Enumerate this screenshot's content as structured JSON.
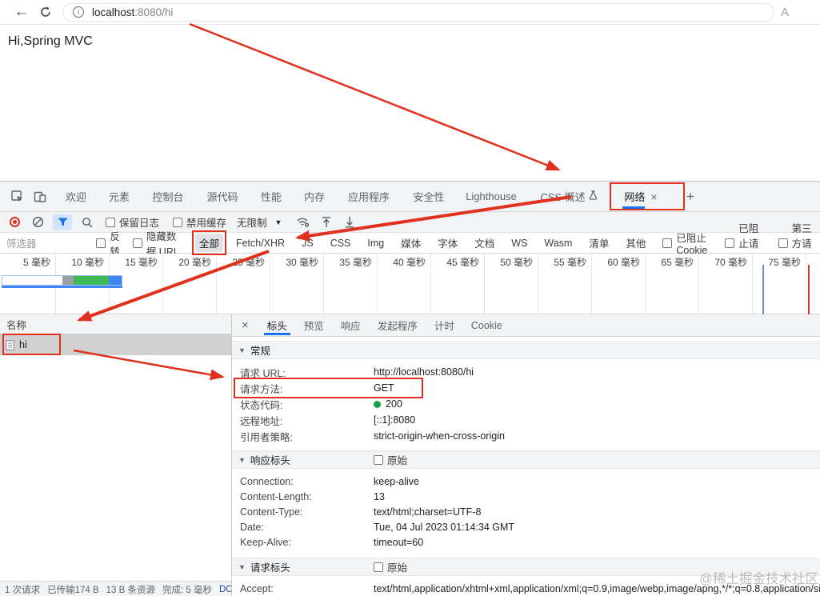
{
  "colors": {
    "annotation": "#e0301e",
    "accent": "#1a73e8",
    "record": "#d93025",
    "status_green": "#12a347",
    "selected_row": "#d0d0d0",
    "dcl_line": "#7086cf",
    "load_line": "#c9392c",
    "ov_gray": "#9aa0a6",
    "ov_green": "#3cba54",
    "ov_blue": "#4285f4"
  },
  "browser": {
    "url": {
      "host": "localhost",
      "rest": ":8080/hi"
    },
    "toolbar_right": "A",
    "page_text": "Hi,Spring MVC"
  },
  "devtools": {
    "tabs": [
      "欢迎",
      "元素",
      "控制台",
      "源代码",
      "性能",
      "内存",
      "应用程序",
      "安全性",
      "Lighthouse",
      "CSS 概述",
      "网络"
    ],
    "network_tab_close": "×",
    "add_tab": "+"
  },
  "network_panel": {
    "toolbar": {
      "preserve_log": "保留日志",
      "disable_cache": "禁用缓存",
      "throttling": "无限制"
    },
    "filter_bar": {
      "placeholder": "筛选器",
      "invert": "反转",
      "hide_data_urls": "隐藏数据 URL",
      "pills": [
        "全部",
        "Fetch/XHR",
        "JS",
        "CSS",
        "Img",
        "媒体",
        "字体",
        "文档",
        "WS",
        "Wasm",
        "清单",
        "其他"
      ],
      "checkboxes": [
        "已阻止 Cookie",
        "已阻止请求",
        "第三方请求"
      ]
    },
    "timeline": {
      "unit": "毫秒",
      "ticks": [
        5,
        10,
        15,
        20,
        25,
        30,
        35,
        40,
        45,
        50,
        55,
        60,
        65,
        70,
        75
      ]
    },
    "request_table": {
      "name_header": "名称",
      "rows": [
        {
          "name": "hi"
        }
      ]
    },
    "summary_bar": {
      "requests": "1 次请求",
      "transferred": "已传输174 B",
      "resources": "13 B 条资源",
      "finish": "完成: 5 毫秒",
      "domcontentloaded": "DC"
    }
  },
  "details": {
    "tabs": [
      "标头",
      "预览",
      "响应",
      "发起程序",
      "计时",
      "Cookie"
    ],
    "close": "×",
    "general": {
      "title": "常规",
      "rows": [
        {
          "label": "请求 URL:",
          "value": "http://localhost:8080/hi"
        },
        {
          "label": "请求方法:",
          "value": "GET"
        },
        {
          "label": "状态代码:",
          "value": "200"
        },
        {
          "label": "远程地址:",
          "value": "[::1]:8080"
        },
        {
          "label": "引用者策略:",
          "value": "strict-origin-when-cross-origin"
        }
      ]
    },
    "response_headers": {
      "title": "响应标头",
      "raw_label": "原始",
      "rows": [
        {
          "label": "Connection:",
          "value": "keep-alive"
        },
        {
          "label": "Content-Length:",
          "value": "13"
        },
        {
          "label": "Content-Type:",
          "value": "text/html;charset=UTF-8"
        },
        {
          "label": "Date:",
          "value": "Tue, 04 Jul 2023 01:14:34 GMT"
        },
        {
          "label": "Keep-Alive:",
          "value": "timeout=60"
        }
      ]
    },
    "request_headers": {
      "title": "请求标头",
      "raw_label": "原始",
      "rows": [
        {
          "label": "Accept:",
          "value": "text/html,application/xhtml+xml,application/xml;q=0.9,image/webp,image/apng,*/*;q=0.8,application/signed"
        }
      ]
    }
  },
  "watermark": "@稀土掘金技术社区"
}
